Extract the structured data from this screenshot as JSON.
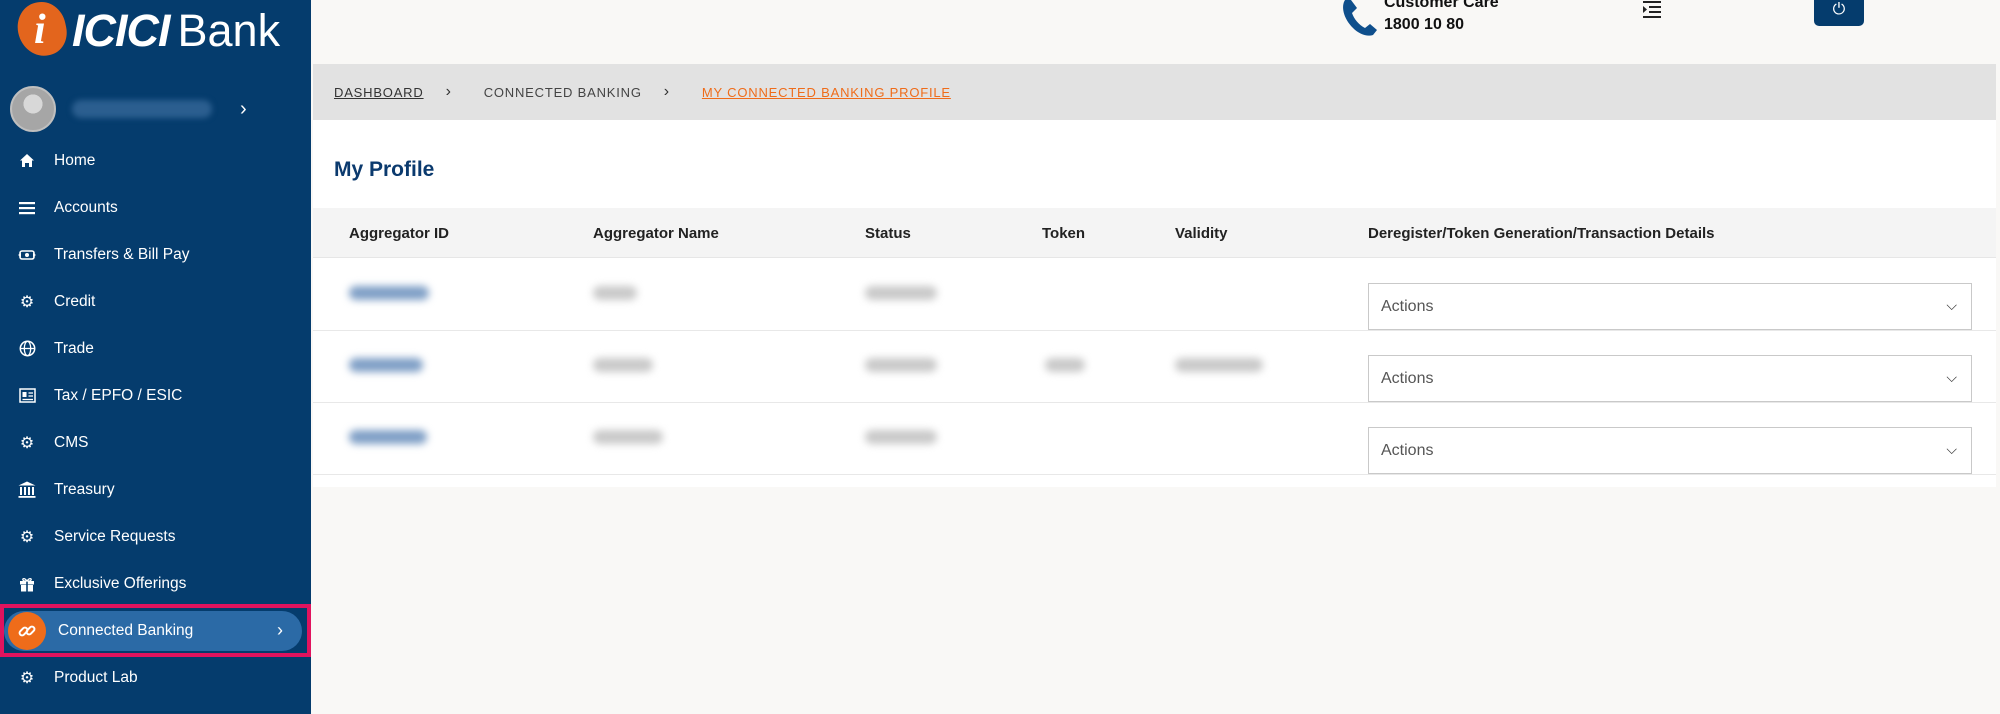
{
  "brand": {
    "logo_text": "ICICI",
    "logo_text_2": "Bank"
  },
  "sidebar": {
    "items": [
      {
        "label": "Home",
        "icon": "home-icon"
      },
      {
        "label": "Accounts",
        "icon": "list-icon"
      },
      {
        "label": "Transfers & Bill Pay",
        "icon": "transfer-icon"
      },
      {
        "label": "Credit",
        "icon": "gear-icon"
      },
      {
        "label": "Trade",
        "icon": "globe-icon"
      },
      {
        "label": "Tax / EPFO / ESIC",
        "icon": "document-icon"
      },
      {
        "label": "CMS",
        "icon": "gear-icon"
      },
      {
        "label": "Treasury",
        "icon": "bank-building-icon"
      },
      {
        "label": "Service Requests",
        "icon": "gear-icon"
      },
      {
        "label": "Exclusive Offerings",
        "icon": "gift-icon"
      },
      {
        "label": "Connected Banking",
        "icon": "link-icon"
      },
      {
        "label": "Product Lab",
        "icon": "gear-icon"
      }
    ]
  },
  "header": {
    "care_title": "Customer Care",
    "care_number": "1800 10 80"
  },
  "breadcrumb": {
    "items": [
      "DASHBOARD",
      "CONNECTED BANKING",
      "MY CONNECTED BANKING PROFILE"
    ]
  },
  "main": {
    "title": "My Profile",
    "columns": [
      "Aggregator ID",
      "Aggregator Name",
      "Status",
      "Token",
      "Validity",
      "Deregister/Token Generation/Transaction Details"
    ],
    "rows": [
      {
        "action": "Actions"
      },
      {
        "action": "Actions"
      },
      {
        "action": "Actions"
      }
    ]
  },
  "colors": {
    "sidebar_bg": "#053c6d",
    "accent_orange": "#ef6c1a",
    "highlight_frame": "#e1135e",
    "title_blue": "#0b3a6e"
  }
}
